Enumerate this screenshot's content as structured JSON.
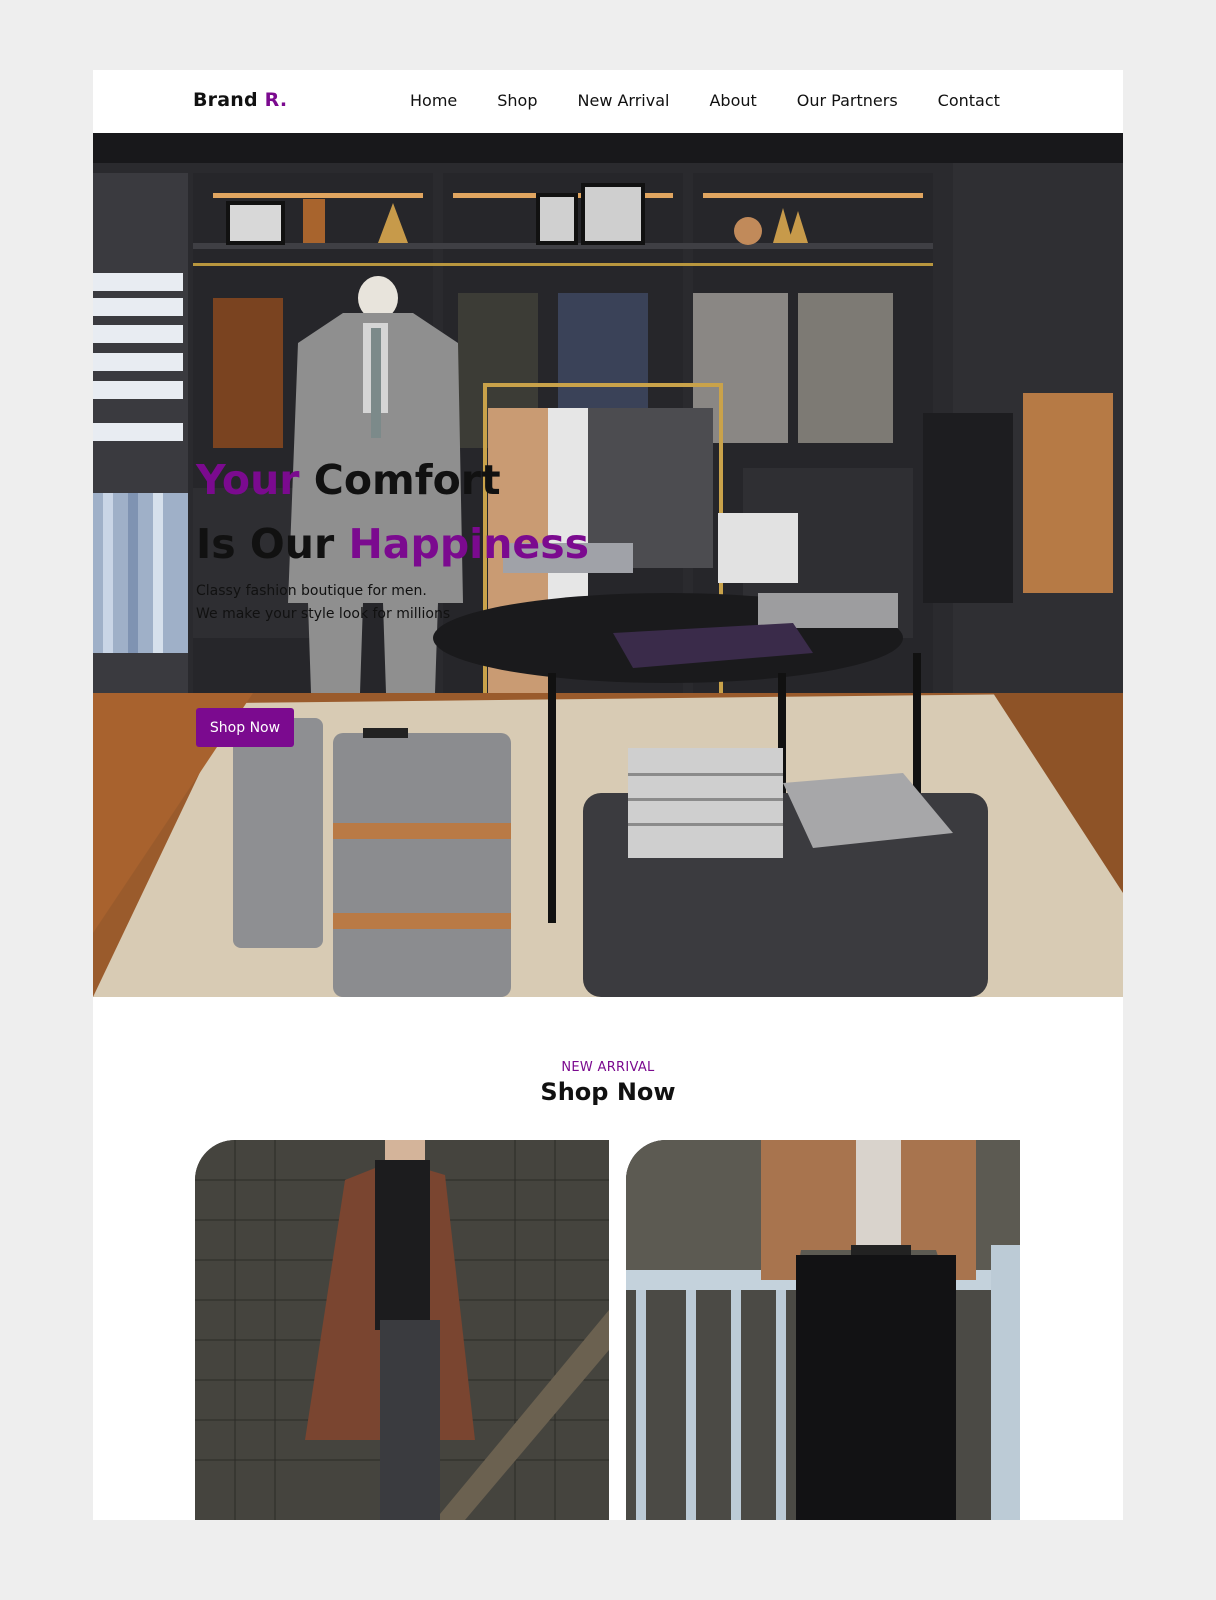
{
  "nav": {
    "brand_name": "Brand",
    "brand_accent": "R.",
    "items": [
      {
        "label": "Home"
      },
      {
        "label": "Shop"
      },
      {
        "label": "New Arrival"
      },
      {
        "label": "About"
      },
      {
        "label": "Our Partners"
      },
      {
        "label": "Contact"
      }
    ]
  },
  "hero": {
    "headline_line1_accent": "Your",
    "headline_line1_rest": "Comfort",
    "headline_line2_rest": "Is Our",
    "headline_line2_accent": "Happiness",
    "subtext_line1": "Classy fashion boutique for men.",
    "subtext_line2": "We make your style look for millions",
    "button_label": "Shop Now",
    "image_icon": "menswear-store-photo"
  },
  "new_arrival": {
    "eyebrow": "NEW ARRIVAL",
    "title": "Shop Now",
    "products": [
      {
        "image_icon": "brown-overcoat-model-photo"
      },
      {
        "image_icon": "suede-jacket-model-photo"
      }
    ]
  },
  "colors": {
    "accent": "#7b0a8f",
    "page_bg": "#eeeeee",
    "text": "#111111"
  }
}
